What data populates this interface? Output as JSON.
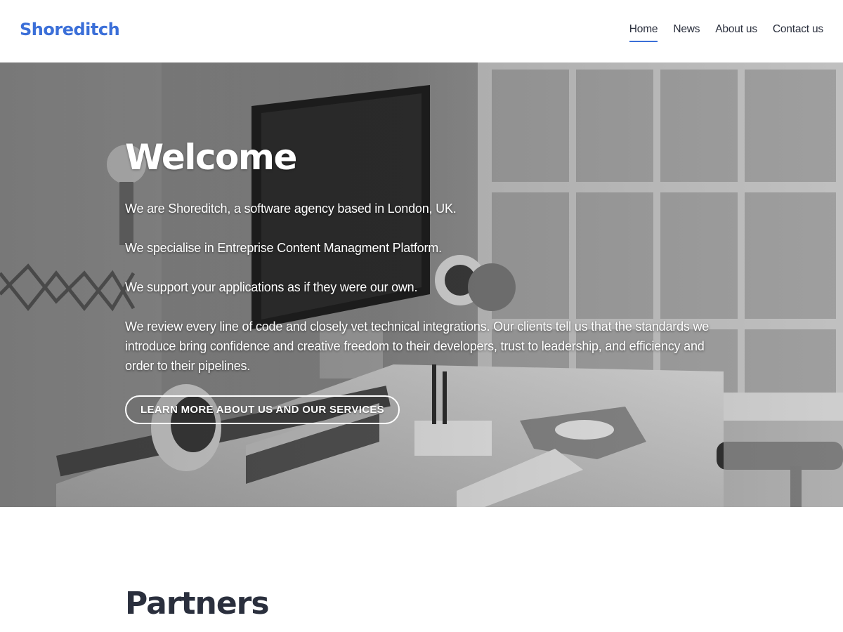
{
  "colors": {
    "brand": "#3b6fd8",
    "nav_active_underline": "#3b6fd8",
    "text_dark": "#2a2f3d",
    "hero_text": "#ffffff"
  },
  "header": {
    "logo": "Shoreditch",
    "nav": [
      {
        "label": "Home",
        "active": true
      },
      {
        "label": "News",
        "active": false
      },
      {
        "label": "About us",
        "active": false
      },
      {
        "label": "Contact us",
        "active": false
      }
    ]
  },
  "hero": {
    "background_image": "grayscale photo of a desk with iMac, speakers, lamp and window",
    "title": "Welcome",
    "paragraphs": [
      "We are Shoreditch, a software agency based in London, UK.",
      "We specialise in Entreprise Content Managment Platform.",
      "We support your applications as if they were our own.",
      "We review every line of code and closely vet technical integrations. Our clients tell us that the standards we introduce bring confidence and creative freedom to their developers, trust to leadership, and efficiency and order to their pipelines."
    ],
    "cta_label": "Learn more about us and our services"
  },
  "partners": {
    "title": "Partners"
  }
}
